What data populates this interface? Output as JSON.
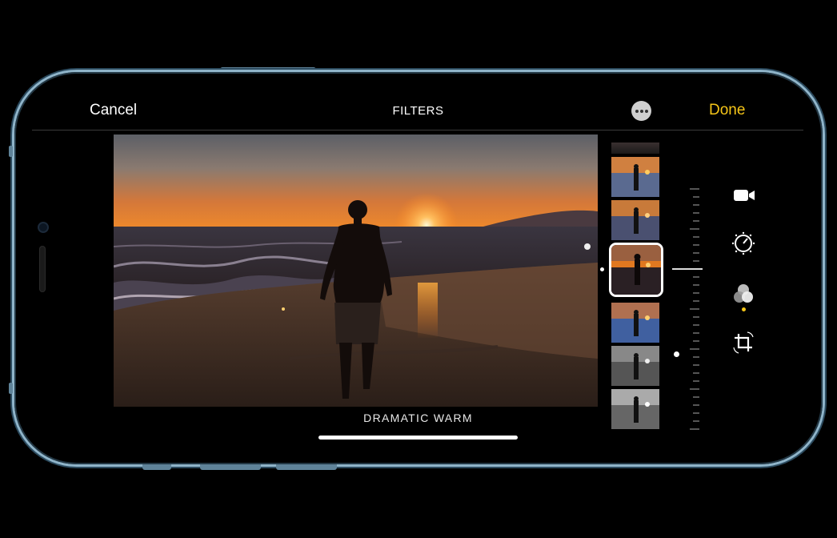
{
  "toolbar": {
    "cancel_label": "Cancel",
    "title": "FILTERS",
    "more_icon": "ellipsis-circle-icon",
    "done_label": "Done"
  },
  "photo": {
    "filter_name": "DRAMATIC WARM"
  },
  "filter_strip": {
    "thumbnails": [
      {
        "style": "vivid-warm"
      },
      {
        "style": "vivid"
      },
      {
        "style": "dramatic-warm",
        "selected": true
      },
      {
        "style": "dramatic-cool"
      },
      {
        "style": "mono"
      },
      {
        "style": "silvertone"
      }
    ]
  },
  "side_tools": [
    {
      "icon": "video-camera-icon"
    },
    {
      "icon": "adjust-dial-icon"
    },
    {
      "icon": "filters-icon",
      "active": true
    },
    {
      "icon": "crop-rotate-icon"
    }
  ],
  "colors": {
    "accent": "#f5c518",
    "frame": "#8fb4c9",
    "sky_top": "#5c5f66",
    "sky_glow": "#e8752a"
  }
}
